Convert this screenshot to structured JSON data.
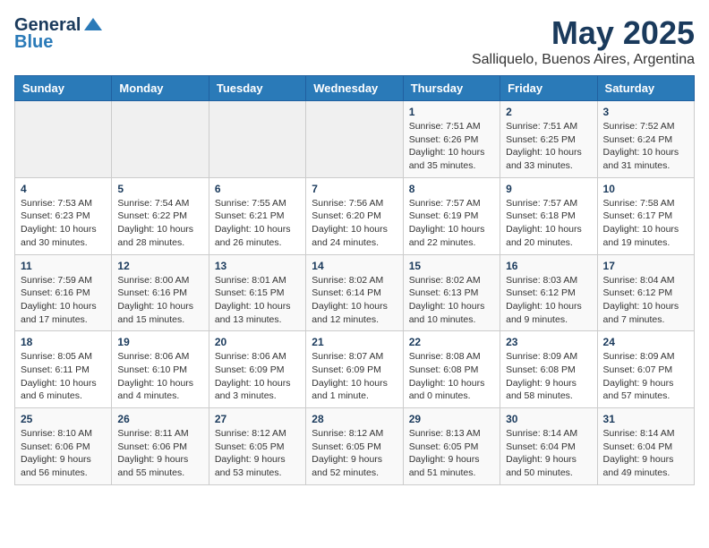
{
  "header": {
    "logo_general": "General",
    "logo_blue": "Blue",
    "month": "May 2025",
    "location": "Salliquelo, Buenos Aires, Argentina"
  },
  "weekdays": [
    "Sunday",
    "Monday",
    "Tuesday",
    "Wednesday",
    "Thursday",
    "Friday",
    "Saturday"
  ],
  "weeks": [
    [
      {
        "day": null,
        "info": null
      },
      {
        "day": null,
        "info": null
      },
      {
        "day": null,
        "info": null
      },
      {
        "day": null,
        "info": null
      },
      {
        "day": "1",
        "info": "Sunrise: 7:51 AM\nSunset: 6:26 PM\nDaylight: 10 hours\nand 35 minutes."
      },
      {
        "day": "2",
        "info": "Sunrise: 7:51 AM\nSunset: 6:25 PM\nDaylight: 10 hours\nand 33 minutes."
      },
      {
        "day": "3",
        "info": "Sunrise: 7:52 AM\nSunset: 6:24 PM\nDaylight: 10 hours\nand 31 minutes."
      }
    ],
    [
      {
        "day": "4",
        "info": "Sunrise: 7:53 AM\nSunset: 6:23 PM\nDaylight: 10 hours\nand 30 minutes."
      },
      {
        "day": "5",
        "info": "Sunrise: 7:54 AM\nSunset: 6:22 PM\nDaylight: 10 hours\nand 28 minutes."
      },
      {
        "day": "6",
        "info": "Sunrise: 7:55 AM\nSunset: 6:21 PM\nDaylight: 10 hours\nand 26 minutes."
      },
      {
        "day": "7",
        "info": "Sunrise: 7:56 AM\nSunset: 6:20 PM\nDaylight: 10 hours\nand 24 minutes."
      },
      {
        "day": "8",
        "info": "Sunrise: 7:57 AM\nSunset: 6:19 PM\nDaylight: 10 hours\nand 22 minutes."
      },
      {
        "day": "9",
        "info": "Sunrise: 7:57 AM\nSunset: 6:18 PM\nDaylight: 10 hours\nand 20 minutes."
      },
      {
        "day": "10",
        "info": "Sunrise: 7:58 AM\nSunset: 6:17 PM\nDaylight: 10 hours\nand 19 minutes."
      }
    ],
    [
      {
        "day": "11",
        "info": "Sunrise: 7:59 AM\nSunset: 6:16 PM\nDaylight: 10 hours\nand 17 minutes."
      },
      {
        "day": "12",
        "info": "Sunrise: 8:00 AM\nSunset: 6:16 PM\nDaylight: 10 hours\nand 15 minutes."
      },
      {
        "day": "13",
        "info": "Sunrise: 8:01 AM\nSunset: 6:15 PM\nDaylight: 10 hours\nand 13 minutes."
      },
      {
        "day": "14",
        "info": "Sunrise: 8:02 AM\nSunset: 6:14 PM\nDaylight: 10 hours\nand 12 minutes."
      },
      {
        "day": "15",
        "info": "Sunrise: 8:02 AM\nSunset: 6:13 PM\nDaylight: 10 hours\nand 10 minutes."
      },
      {
        "day": "16",
        "info": "Sunrise: 8:03 AM\nSunset: 6:12 PM\nDaylight: 10 hours\nand 9 minutes."
      },
      {
        "day": "17",
        "info": "Sunrise: 8:04 AM\nSunset: 6:12 PM\nDaylight: 10 hours\nand 7 minutes."
      }
    ],
    [
      {
        "day": "18",
        "info": "Sunrise: 8:05 AM\nSunset: 6:11 PM\nDaylight: 10 hours\nand 6 minutes."
      },
      {
        "day": "19",
        "info": "Sunrise: 8:06 AM\nSunset: 6:10 PM\nDaylight: 10 hours\nand 4 minutes."
      },
      {
        "day": "20",
        "info": "Sunrise: 8:06 AM\nSunset: 6:09 PM\nDaylight: 10 hours\nand 3 minutes."
      },
      {
        "day": "21",
        "info": "Sunrise: 8:07 AM\nSunset: 6:09 PM\nDaylight: 10 hours\nand 1 minute."
      },
      {
        "day": "22",
        "info": "Sunrise: 8:08 AM\nSunset: 6:08 PM\nDaylight: 10 hours\nand 0 minutes."
      },
      {
        "day": "23",
        "info": "Sunrise: 8:09 AM\nSunset: 6:08 PM\nDaylight: 9 hours\nand 58 minutes."
      },
      {
        "day": "24",
        "info": "Sunrise: 8:09 AM\nSunset: 6:07 PM\nDaylight: 9 hours\nand 57 minutes."
      }
    ],
    [
      {
        "day": "25",
        "info": "Sunrise: 8:10 AM\nSunset: 6:06 PM\nDaylight: 9 hours\nand 56 minutes."
      },
      {
        "day": "26",
        "info": "Sunrise: 8:11 AM\nSunset: 6:06 PM\nDaylight: 9 hours\nand 55 minutes."
      },
      {
        "day": "27",
        "info": "Sunrise: 8:12 AM\nSunset: 6:05 PM\nDaylight: 9 hours\nand 53 minutes."
      },
      {
        "day": "28",
        "info": "Sunrise: 8:12 AM\nSunset: 6:05 PM\nDaylight: 9 hours\nand 52 minutes."
      },
      {
        "day": "29",
        "info": "Sunrise: 8:13 AM\nSunset: 6:05 PM\nDaylight: 9 hours\nand 51 minutes."
      },
      {
        "day": "30",
        "info": "Sunrise: 8:14 AM\nSunset: 6:04 PM\nDaylight: 9 hours\nand 50 minutes."
      },
      {
        "day": "31",
        "info": "Sunrise: 8:14 AM\nSunset: 6:04 PM\nDaylight: 9 hours\nand 49 minutes."
      }
    ]
  ]
}
